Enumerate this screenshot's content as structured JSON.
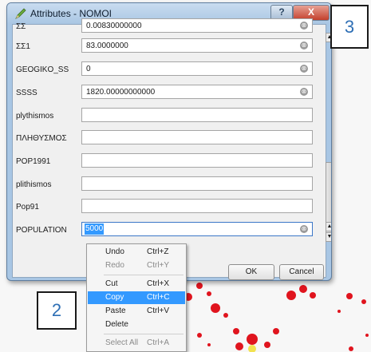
{
  "window": {
    "title": "Attributes - NOMOI",
    "help_label": "?",
    "close_label": "X"
  },
  "rows": [
    {
      "label": "ΣΣ",
      "value": "0.00830000000"
    },
    {
      "label": "ΣΣ1",
      "value": "83.0000000"
    },
    {
      "label": "GEOGIKO_SS",
      "value": "0"
    },
    {
      "label": "SSSS",
      "value": "1820.00000000000"
    },
    {
      "label": "plythismos",
      "value": ""
    },
    {
      "label": "ΠΛΗΘΥΣΜΟΣ",
      "value": ""
    },
    {
      "label": "POP1991",
      "value": ""
    },
    {
      "label": "plithismos",
      "value": ""
    },
    {
      "label": "Pop91",
      "value": ""
    },
    {
      "label": "POPULATION",
      "value": "5000"
    }
  ],
  "buttons": {
    "ok": "OK",
    "cancel": "Cancel"
  },
  "context_menu": [
    {
      "label": "Undo",
      "shortcut": "Ctrl+Z",
      "disabled": false
    },
    {
      "label": "Redo",
      "shortcut": "Ctrl+Y",
      "disabled": true
    },
    {
      "label": "Cut",
      "shortcut": "Ctrl+X",
      "disabled": false
    },
    {
      "label": "Copy",
      "shortcut": "Ctrl+C",
      "disabled": false,
      "highlighted": true
    },
    {
      "label": "Paste",
      "shortcut": "Ctrl+V",
      "disabled": false
    },
    {
      "label": "Delete",
      "shortcut": "",
      "disabled": false
    },
    {
      "label": "Select All",
      "shortcut": "Ctrl+A",
      "disabled": true
    }
  ],
  "annotations": {
    "three": "3",
    "two": "2"
  },
  "colors": {
    "selection": "#3399ff",
    "map_feature": "#e0141e",
    "annotation_text": "#2e6fb5"
  },
  "icons": {
    "title": "qgis-pencil-icon",
    "clear": "clear-field-icon"
  }
}
